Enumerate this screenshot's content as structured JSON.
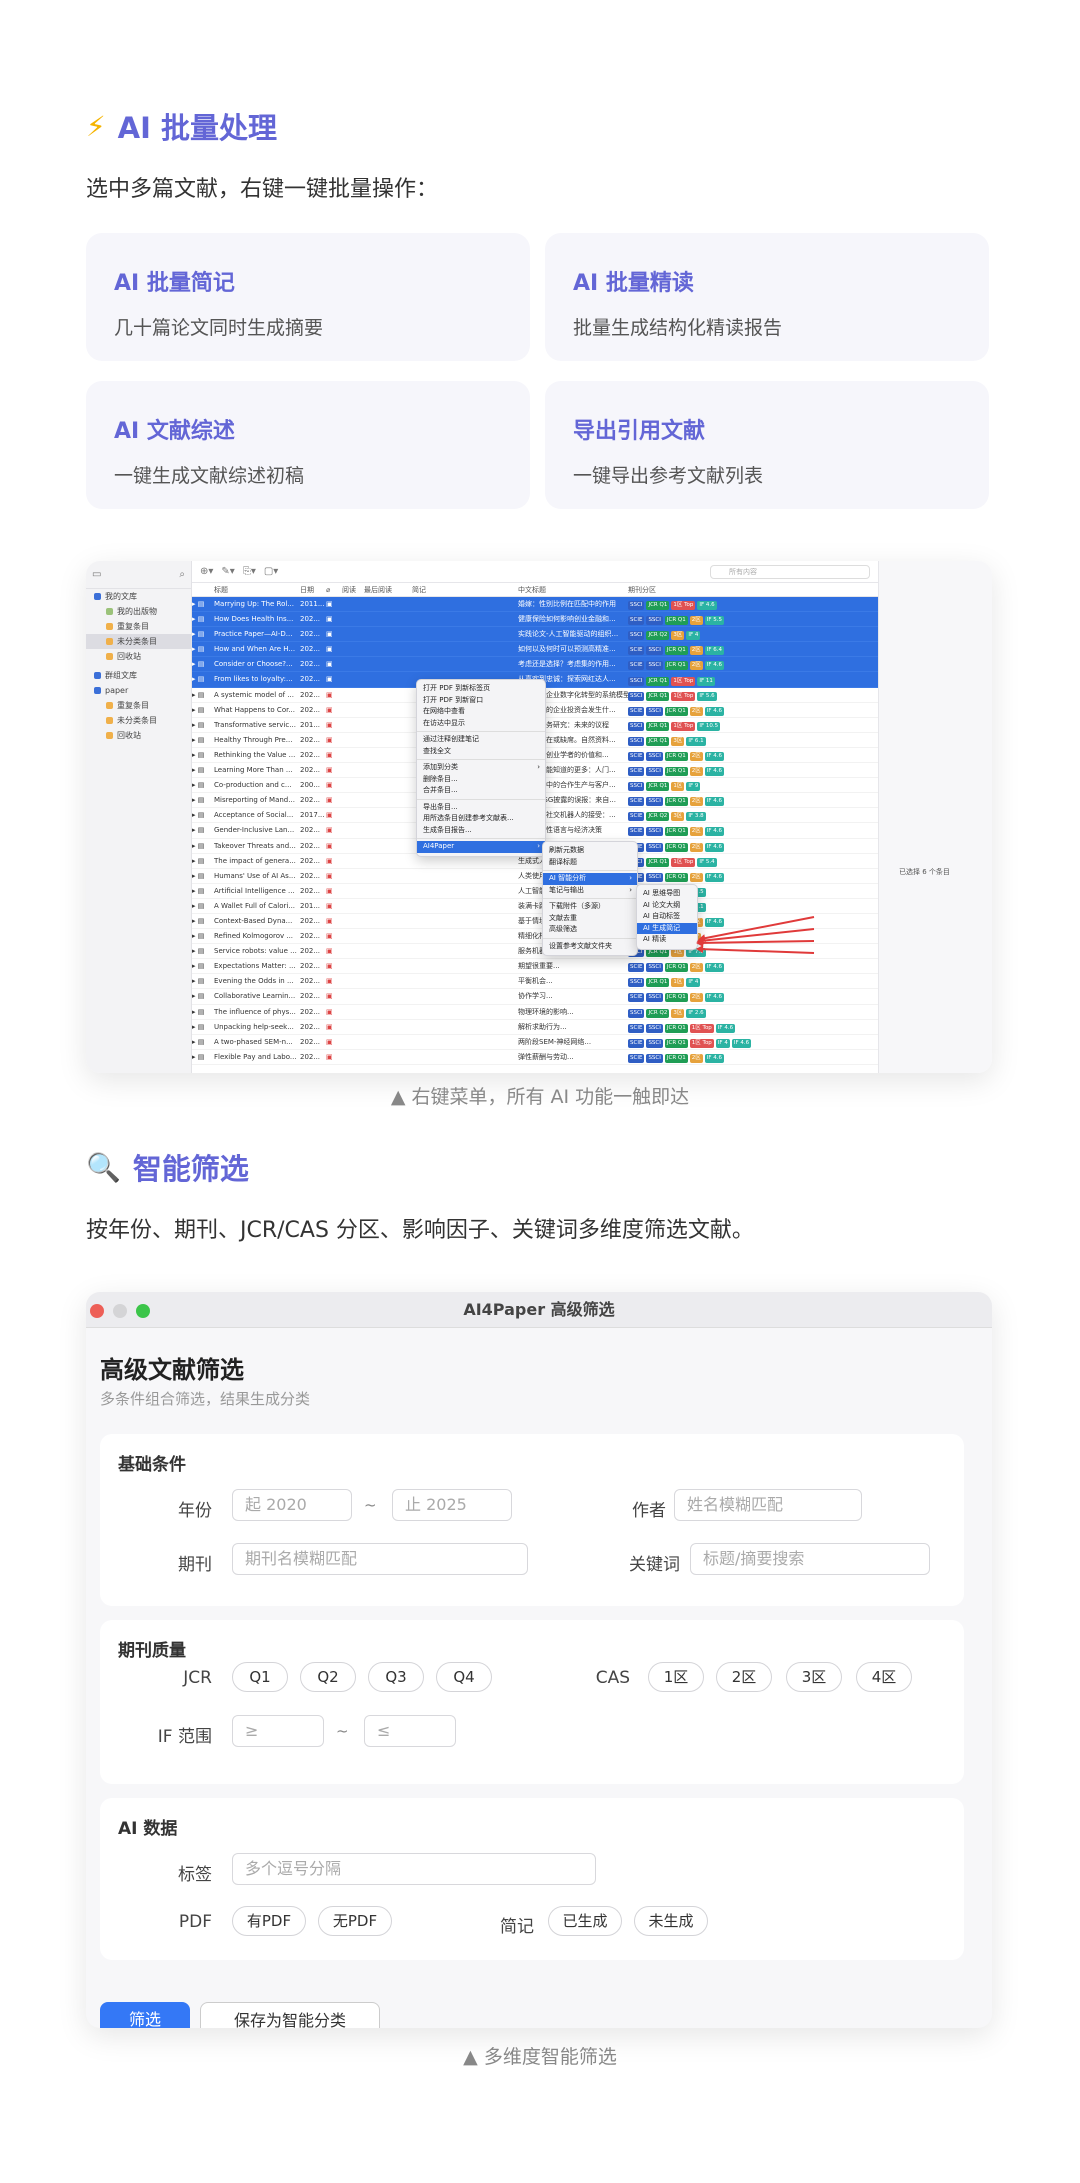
{
  "section1": {
    "icon": "⚡",
    "title": "AI 批量处理",
    "desc": "选中多篇文献，右键一键批量操作：",
    "cards": [
      {
        "title": "AI 批量简记",
        "desc": "几十篇论文同时生成摘要"
      },
      {
        "title": "AI 批量精读",
        "desc": "批量生成结构化精读报告"
      },
      {
        "title": "AI 文献综述",
        "desc": "一键生成文献综述初稿"
      },
      {
        "title": "导出引用文献",
        "desc": "一键导出参考文献列表"
      }
    ],
    "caption": "▲ 右键菜单，所有 AI 功能一触即达"
  },
  "zotero": {
    "sidebar": [
      "我的文库",
      "我的出版物",
      "重复条目",
      "未分类条目",
      "回收站",
      "群组文库",
      "paper",
      "重复条目",
      "未分类条目",
      "回收站"
    ],
    "search_placeholder": "所有内容",
    "columns": [
      "标题",
      "日期",
      "阅读",
      "最后阅读",
      "简记",
      "中文标题",
      "期刊分区"
    ],
    "rows": [
      {
        "t": "Marrying Up: The Rol...",
        "d": "2011...",
        "zh": "婚嫁：性别比例在匹配中的作用",
        "tags": [
          "SSCI",
          "JCR Q1",
          "1区 Top",
          "IF 4.6"
        ]
      },
      {
        "t": "How Does Health Ins...",
        "d": "202...",
        "zh": "健康保险如何影响创业金融和...",
        "tags": [
          "SCIE",
          "SSCI",
          "JCR Q1",
          "2区",
          "IF 5.5"
        ]
      },
      {
        "t": "Practice Paper—AI-D...",
        "d": "202...",
        "zh": "实践论文-人工智能驱动的组织...",
        "tags": [
          "SSCI",
          "JCR Q2",
          "3区",
          "IF 4"
        ]
      },
      {
        "t": "How and When Are H...",
        "d": "202...",
        "zh": "如何以及何时可以预测高精准...",
        "tags": [
          "SCIE",
          "SSCI",
          "JCR Q1",
          "2区",
          "IF 6.4"
        ]
      },
      {
        "t": "Consider or Choose?...",
        "d": "202...",
        "zh": "考虑还是选择？考虑集的作用...",
        "tags": [
          "SCIE",
          "SSCI",
          "JCR Q1",
          "2区",
          "IF 4.6"
        ]
      },
      {
        "t": "From likes to loyalty:...",
        "d": "202...",
        "zh": "从喜欢到忠诚：探索网红达人...",
        "tags": [
          "SSCI",
          "JCR Q1",
          "1区 Top",
          "IF 11"
        ]
      },
      {
        "t": "A systemic model of ...",
        "d": "202...",
        "zh": "揭示中小企业数字化转型的系统模型",
        "tags": [
          "SSCI",
          "JCR Q1",
          "1区 Top",
          "IF 5.6"
        ]
      },
      {
        "t": "What Happens to Cor...",
        "d": "202...",
        "zh": "糟糕时期的企业投资会发生什...",
        "tags": [
          "SCIE",
          "SSCI",
          "JCR Q1",
          "2区",
          "IF 4.6"
        ]
      },
      {
        "t": "Transformative servic...",
        "d": "201...",
        "zh": "变革性服务研究：未来的议程",
        "tags": [
          "SSCI",
          "JCR Q1",
          "1区 Top",
          "IF 10.5"
        ]
      },
      {
        "t": "Healthy Through Pre...",
        "d": "202...",
        "zh": "健康的存在或缺席。自然资料...",
        "tags": [
          "SSCI",
          "JCR Q1",
          "3区",
          "IF 6.1"
        ]
      },
      {
        "t": "Rethinking the Value ...",
        "d": "202...",
        "zh": "重新思考创业学者的价值和...",
        "tags": [
          "SCIE",
          "SSCI",
          "JCR Q1",
          "2区",
          "IF 4.6"
        ]
      },
      {
        "t": "Learning More Than ...",
        "d": "202...",
        "zh": "学习比你能知道的更多：人门...",
        "tags": [
          "SCIE",
          "SSCI",
          "JCR Q1",
          "2区",
          "IF 4.6"
        ]
      },
      {
        "t": "Co-production and c...",
        "d": "200...",
        "zh": "金融服务中的合作生产与客户...",
        "tags": [
          "SSCI",
          "JCR Q1",
          "1区",
          "IF 9"
        ]
      },
      {
        "t": "Misreporting of Mand...",
        "d": "202...",
        "zh": "强制性ESG披露的误报：来自...",
        "tags": [
          "SCIE",
          "SSCI",
          "JCR Q1",
          "2区",
          "IF 4.6"
        ]
      },
      {
        "t": "Acceptance of Social...",
        "d": "2017...",
        "zh": "老年人对社交机器人的接受：...",
        "tags": [
          "SCIE",
          "JCR Q2",
          "3区",
          "IF 3.8"
        ]
      },
      {
        "t": "Gender-Inclusive Lan...",
        "d": "202...",
        "zh": "性别包容性语言与经济决策",
        "tags": [
          "SCIE",
          "SSCI",
          "JCR Q1",
          "2区",
          "IF 4.6"
        ]
      },
      {
        "t": "Takeover Threats and...",
        "d": "202...",
        "zh": "收购威胁与企业的管理层...",
        "tags": [
          "SCIE",
          "SSCI",
          "JCR Q1",
          "2区",
          "IF 4.6"
        ]
      },
      {
        "t": "The impact of genera...",
        "d": "202...",
        "zh": "生成式人工智能对...",
        "tags": [
          "SSCI",
          "JCR Q1",
          "1区 Top",
          "IF 5.4"
        ]
      },
      {
        "t": "Humans' Use of AI As...",
        "d": "202...",
        "zh": "人类使用人工智能助手...",
        "tags": [
          "SCIE",
          "SSCI",
          "JCR Q1",
          "2区",
          "IF 4.6"
        ]
      },
      {
        "t": "Artificial Intelligence ...",
        "d": "202...",
        "zh": "人工智能...",
        "tags": [
          "SSCI",
          "JCR Q1",
          "1区",
          "IF 5.5"
        ]
      },
      {
        "t": "A Wallet Full of Calori...",
        "d": "201...",
        "zh": "装满卡路里的钱包...",
        "tags": [
          "SSCI",
          "JCR Q1",
          "1区",
          "IF 5.1"
        ]
      },
      {
        "t": "Context-Based Dyna...",
        "d": "202...",
        "zh": "基于情境的动态...",
        "tags": [
          "SCIE",
          "SSCI",
          "JCR Q1",
          "2区",
          "IF 4.6"
        ]
      },
      {
        "t": "Refined Kolmogorov ...",
        "d": "202...",
        "zh": "精细化柯尔莫哥洛夫...",
        "tags": [
          "SSCI",
          "JCR Q2",
          "2区",
          "CCF"
        ]
      },
      {
        "t": "Service robots: value ...",
        "d": "202...",
        "zh": "服务机器人：价值...",
        "tags": [
          "SSCI",
          "JCR Q1",
          "1区",
          "IF 7.9"
        ]
      },
      {
        "t": "Expectations Matter: ...",
        "d": "202...",
        "zh": "期望很重要...",
        "tags": [
          "SCIE",
          "SSCI",
          "JCR Q1",
          "2区",
          "IF 4.6"
        ]
      },
      {
        "t": "Evening the Odds in ...",
        "d": "202...",
        "zh": "平衡机会...",
        "tags": [
          "SSCI",
          "JCR Q1",
          "1区",
          "IF 4"
        ]
      },
      {
        "t": "Collaborative Learnin...",
        "d": "202...",
        "zh": "协作学习...",
        "tags": [
          "SCIE",
          "SSCI",
          "JCR Q1",
          "2区",
          "IF 4.6"
        ]
      },
      {
        "t": "The influence of phys...",
        "d": "202...",
        "zh": "物理环境的影响...",
        "tags": [
          "SSCI",
          "JCR Q2",
          "3区",
          "IF 2.6"
        ]
      },
      {
        "t": "Unpacking help-seek...",
        "d": "202...",
        "zh": "解析求助行为...",
        "tags": [
          "SCIE",
          "SSCI",
          "JCR Q1",
          "1区 Top",
          "IF 4.6"
        ]
      },
      {
        "t": "A two-phased SEM-n...",
        "d": "202...",
        "zh": "两阶段SEM-神经网络...",
        "tags": [
          "SCIE",
          "SSCI",
          "JCR Q1",
          "1区 Top",
          "IF 4",
          "IF 4.6"
        ]
      },
      {
        "t": "Flexible Pay and Labo...",
        "d": "202...",
        "zh": "弹性薪酬与劳动...",
        "tags": [
          "SCIE",
          "SSCI",
          "JCR Q1",
          "2区",
          "IF 4.6"
        ]
      }
    ],
    "context_menu": [
      "打开 PDF 到新标签页",
      "打开 PDF 到新窗口",
      "在网络中查看",
      "在访达中显示",
      "通过注释创建笔记",
      "查找全文",
      "添加到分类",
      "删除条目...",
      "合并条目...",
      "导出条目...",
      "用所选条目创建参考文献表...",
      "生成条目报告...",
      "AI4Paper"
    ],
    "ai_menu": [
      "刷新元数据",
      "翻译标题",
      "AI 智能分析",
      "笔记与输出",
      "下载附件（多源）",
      "文献去重",
      "高级筛选",
      "设置参考文献文件夹"
    ],
    "ai_sub_menu": [
      "AI 思维导图",
      "AI 论文大纲",
      "AI 自动标签",
      "AI 生成简记",
      "AI 精读"
    ],
    "selected_count": "已选择 6 个条目"
  },
  "section2": {
    "icon": "🔍",
    "title": "智能筛选",
    "desc": "按年份、期刊、JCR/CAS 分区、影响因子、关键词多维度筛选文献。",
    "caption": "▲ 多维度智能筛选"
  },
  "filter": {
    "window_title": "AI4Paper 高级筛选",
    "title": "高级文献筛选",
    "subtitle": "多条件组合筛选，结果生成分类",
    "basic": {
      "title": "基础条件",
      "year_label": "年份",
      "year_from": "起 2020",
      "year_to": "止 2025",
      "tilde": "~",
      "author_label": "作者",
      "author_placeholder": "姓名模糊匹配",
      "journal_label": "期刊",
      "journal_placeholder": "期刊名模糊匹配",
      "keyword_label": "关键词",
      "keyword_placeholder": "标题/摘要搜索"
    },
    "quality": {
      "title": "期刊质量",
      "jcr_label": "JCR",
      "jcr": [
        "Q1",
        "Q2",
        "Q3",
        "Q4"
      ],
      "cas_label": "CAS",
      "cas": [
        "1区",
        "2区",
        "3区",
        "4区"
      ],
      "if_label": "IF 范围",
      "if_min": "≥",
      "if_max": "≤",
      "tilde": "~"
    },
    "ai": {
      "title": "AI 数据",
      "tag_label": "标签",
      "tag_placeholder": "多个逗号分隔",
      "pdf_label": "PDF",
      "pdf": [
        "有PDF",
        "无PDF"
      ],
      "note_label": "简记",
      "note": [
        "已生成",
        "未生成"
      ]
    },
    "filter_button": "筛选",
    "save_button": "保存为智能分类"
  },
  "colors": {
    "accent": "#6366d6",
    "selection": "#2f6fe0"
  }
}
